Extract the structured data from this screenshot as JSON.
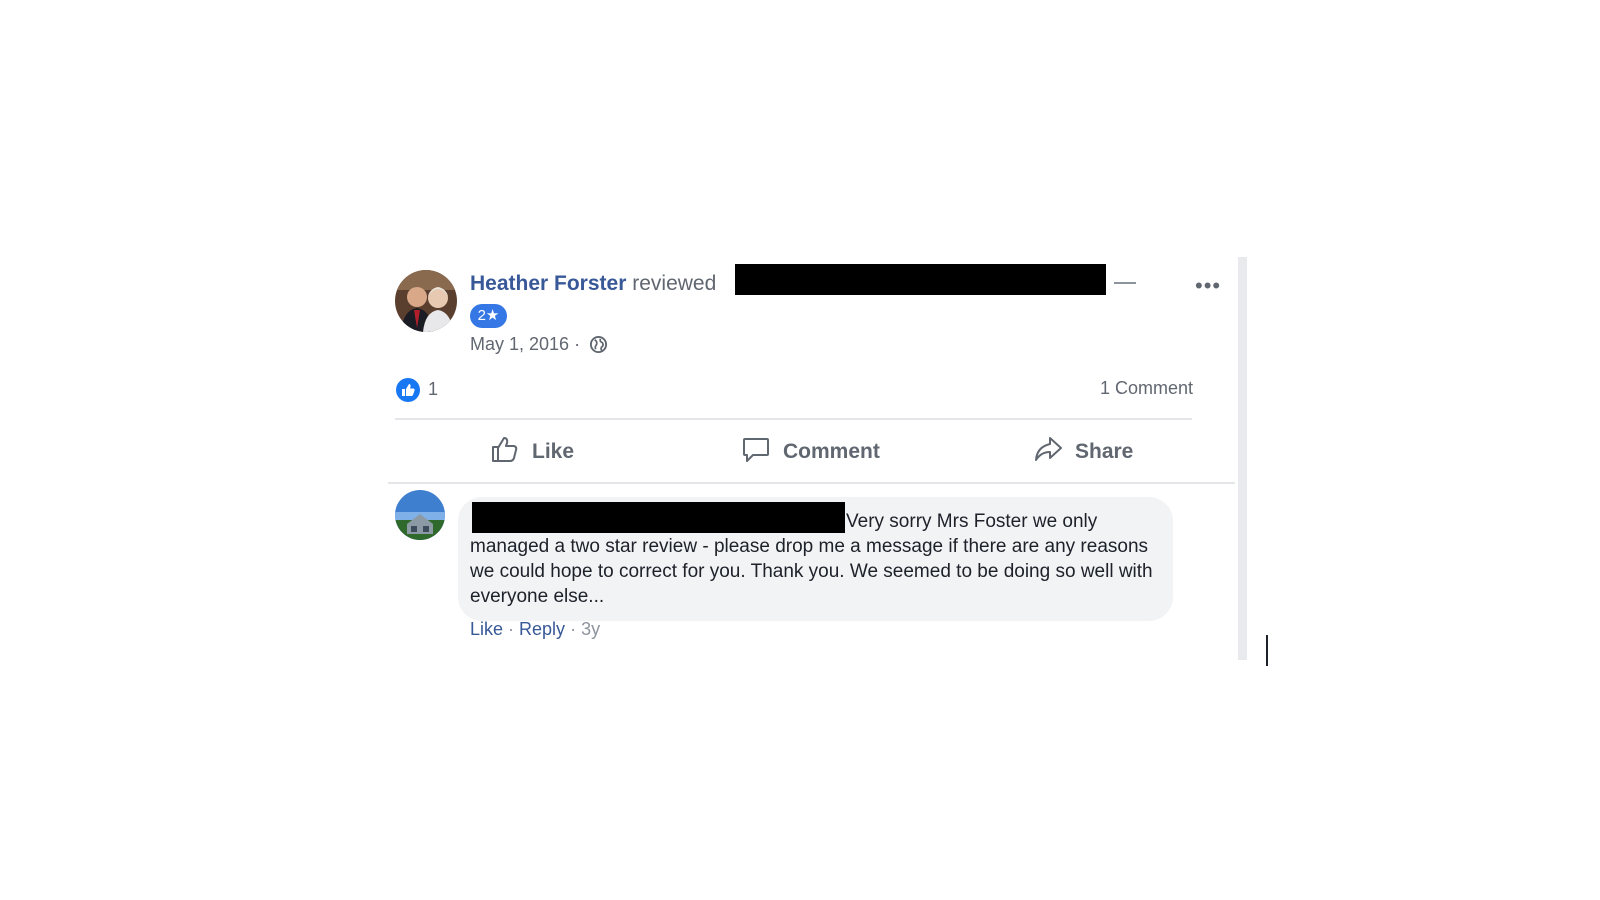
{
  "post": {
    "author": "Heather Forster",
    "action_text": " reviewed",
    "rating_badge": "2★",
    "date": "May 1, 2016 ·",
    "more_menu": "•••",
    "privacy_icon": "globe-icon"
  },
  "stats": {
    "like_count": "1",
    "comment_count": "1 Comment"
  },
  "actions": {
    "like": "Like",
    "comment": "Comment",
    "share": "Share"
  },
  "comment": {
    "text": "Very sorry Mrs Foster we only managed a two star review - please drop me a message if there are any reasons we could hope to correct for you. Thank you. We seemed to be doing so well with everyone else...",
    "like": "Like",
    "separator": " · ",
    "reply": "Reply",
    "time": "3y"
  },
  "colors": {
    "link_blue": "#385898",
    "badge_blue": "#3578e5",
    "like_blue": "#1877f2",
    "muted_gray": "#616770",
    "bubble_gray": "#f2f3f5"
  }
}
